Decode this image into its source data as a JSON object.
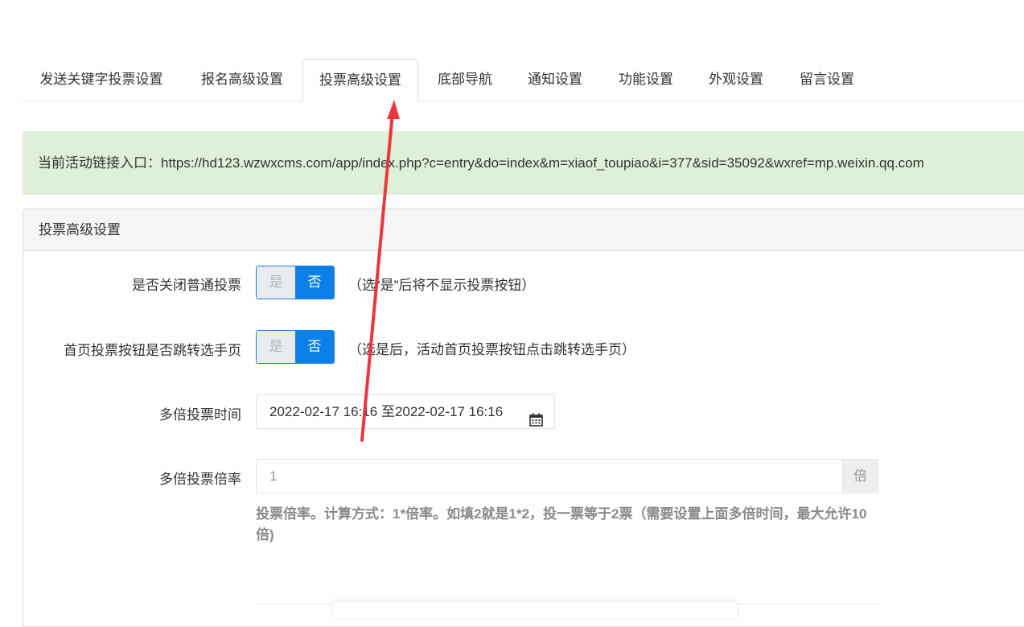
{
  "tabs": [
    {
      "label": "发送关键字投票设置",
      "active": false
    },
    {
      "label": "报名高级设置",
      "active": false
    },
    {
      "label": "投票高级设置",
      "active": true
    },
    {
      "label": "底部导航",
      "active": false
    },
    {
      "label": "通知设置",
      "active": false
    },
    {
      "label": "功能设置",
      "active": false
    },
    {
      "label": "外观设置",
      "active": false
    },
    {
      "label": "留言设置",
      "active": false
    }
  ],
  "alert": {
    "text": "当前活动链接入口：https://hd123.wzwxcms.com/app/index.php?c=entry&do=index&m=xiaof_toupiao&i=377&sid=35092&wxref=mp.weixin.qq.com"
  },
  "panel": {
    "title": "投票高级设置",
    "fields": {
      "close_vote": {
        "label": "是否关闭普通投票",
        "yes": "是",
        "no": "否",
        "selected": "否",
        "hint": "（选“是”后将不显示投票按钮）"
      },
      "jump_select": {
        "label": "首页投票按钮是否跳转选手页",
        "yes": "是",
        "no": "否",
        "selected": "否",
        "hint": "（选是后，活动首页投票按钮点击跳转选手页）"
      },
      "multi_time": {
        "label": "多倍投票时间",
        "value": "2022-02-17 16:16 至2022-02-17 16:16",
        "icon": "calendar-icon"
      },
      "multi_rate": {
        "label": "多倍投票倍率",
        "value": "1",
        "addon": "倍",
        "help": "投票倍率。计算方式：1*倍率。如填2就是1*2，投一票等于2票（需要设置上面多倍时间，最大允许10倍)"
      }
    }
  },
  "colors": {
    "accent": "#0c7fe8",
    "alert_bg": "#dff0d8",
    "annotation_arrow": "#e8383d"
  }
}
